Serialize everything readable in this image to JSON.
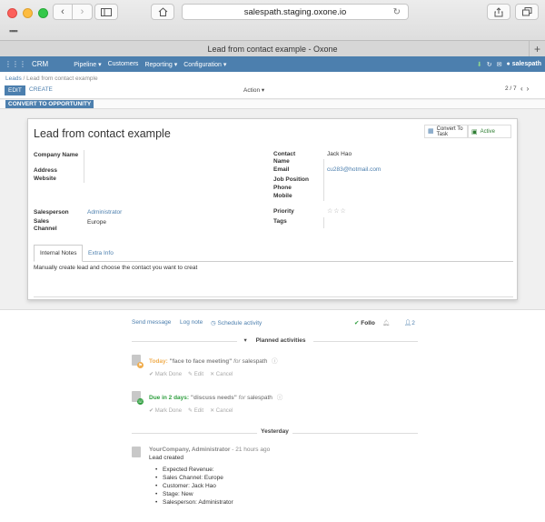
{
  "browser": {
    "url": "salespath.staging.oxone.io",
    "tab_title": "Lead from contact example - Oxone",
    "back_icon": "‹",
    "forward_icon": "›",
    "new_tab_icon": "+"
  },
  "topnav": {
    "apps_icon": "apps-grid-icon",
    "brand": "CRM",
    "menu": [
      "Pipeline ▾",
      "Customers",
      "Reporting ▾",
      "Configuration ▾"
    ],
    "user": "salespath"
  },
  "control_panel": {
    "breadcrumb_root": "Leads",
    "breadcrumb_sep": "/",
    "breadcrumb_current": "Lead from contact example",
    "edit_label": "EDIT",
    "create_label": "CREATE",
    "action_label": "Action ▾",
    "pager": "2 / 7",
    "pager_prev": "‹",
    "pager_next": "›"
  },
  "statusbar": {
    "convert_label": "CONVERT TO OPPORTUNITY"
  },
  "form": {
    "title": "Lead from contact example",
    "smart_buttons": {
      "convert_task": "Convert To Task",
      "active": "Active"
    },
    "left": {
      "company_name_label": "Company Name",
      "address_label": "Address",
      "website_label": "Website",
      "salesperson_label": "Salesperson",
      "salesperson_value": "Administrator",
      "sales_channel_label": "Sales Channel",
      "sales_channel_value": "Europe"
    },
    "right": {
      "contact_name_label": "Contact Name",
      "contact_name_value": "Jack Hao",
      "email_label": "Email",
      "email_value": "cu283@hotmail.com",
      "job_position_label": "Job Position",
      "phone_label": "Phone",
      "mobile_label": "Mobile",
      "priority_label": "Priority",
      "priority_stars": "☆☆☆",
      "priority_value": 0,
      "tags_label": "Tags"
    },
    "tabs": [
      "Internal Notes",
      "Extra Info"
    ],
    "notes": "Manually create lead and choose the contact you want to creat"
  },
  "chatter": {
    "send_message": "Send message",
    "log_note": "Log note",
    "schedule_activity": "Schedule activity",
    "follow": "Follo",
    "followers_count": "2",
    "planned_label": "Planned activities",
    "yesterday_label": "Yesterday",
    "activities": [
      {
        "when": "Today:",
        "summary": "\"face to face meeting\"",
        "for": "for",
        "assignee": "salespath",
        "mark_done": "Mark Done",
        "edit": "Edit",
        "cancel": "Cancel"
      },
      {
        "when": "Due in 2 days:",
        "summary": "\"discuss needs\"",
        "for": "for",
        "assignee": "salespath",
        "mark_done": "Mark Done",
        "edit": "Edit",
        "cancel": "Cancel"
      }
    ],
    "message": {
      "author": "YourCompany, Administrator",
      "time": "- 21 hours ago",
      "body": "Lead created",
      "changes": [
        "Expected Revenue:",
        "Sales Channel: Europe",
        "Customer: Jack Hao",
        "Stage: New",
        "Salesperson: Administrator"
      ]
    }
  },
  "colors": {
    "brand": "#4c7fae",
    "today": "#f0ad4e",
    "due": "#2e9e3e"
  }
}
